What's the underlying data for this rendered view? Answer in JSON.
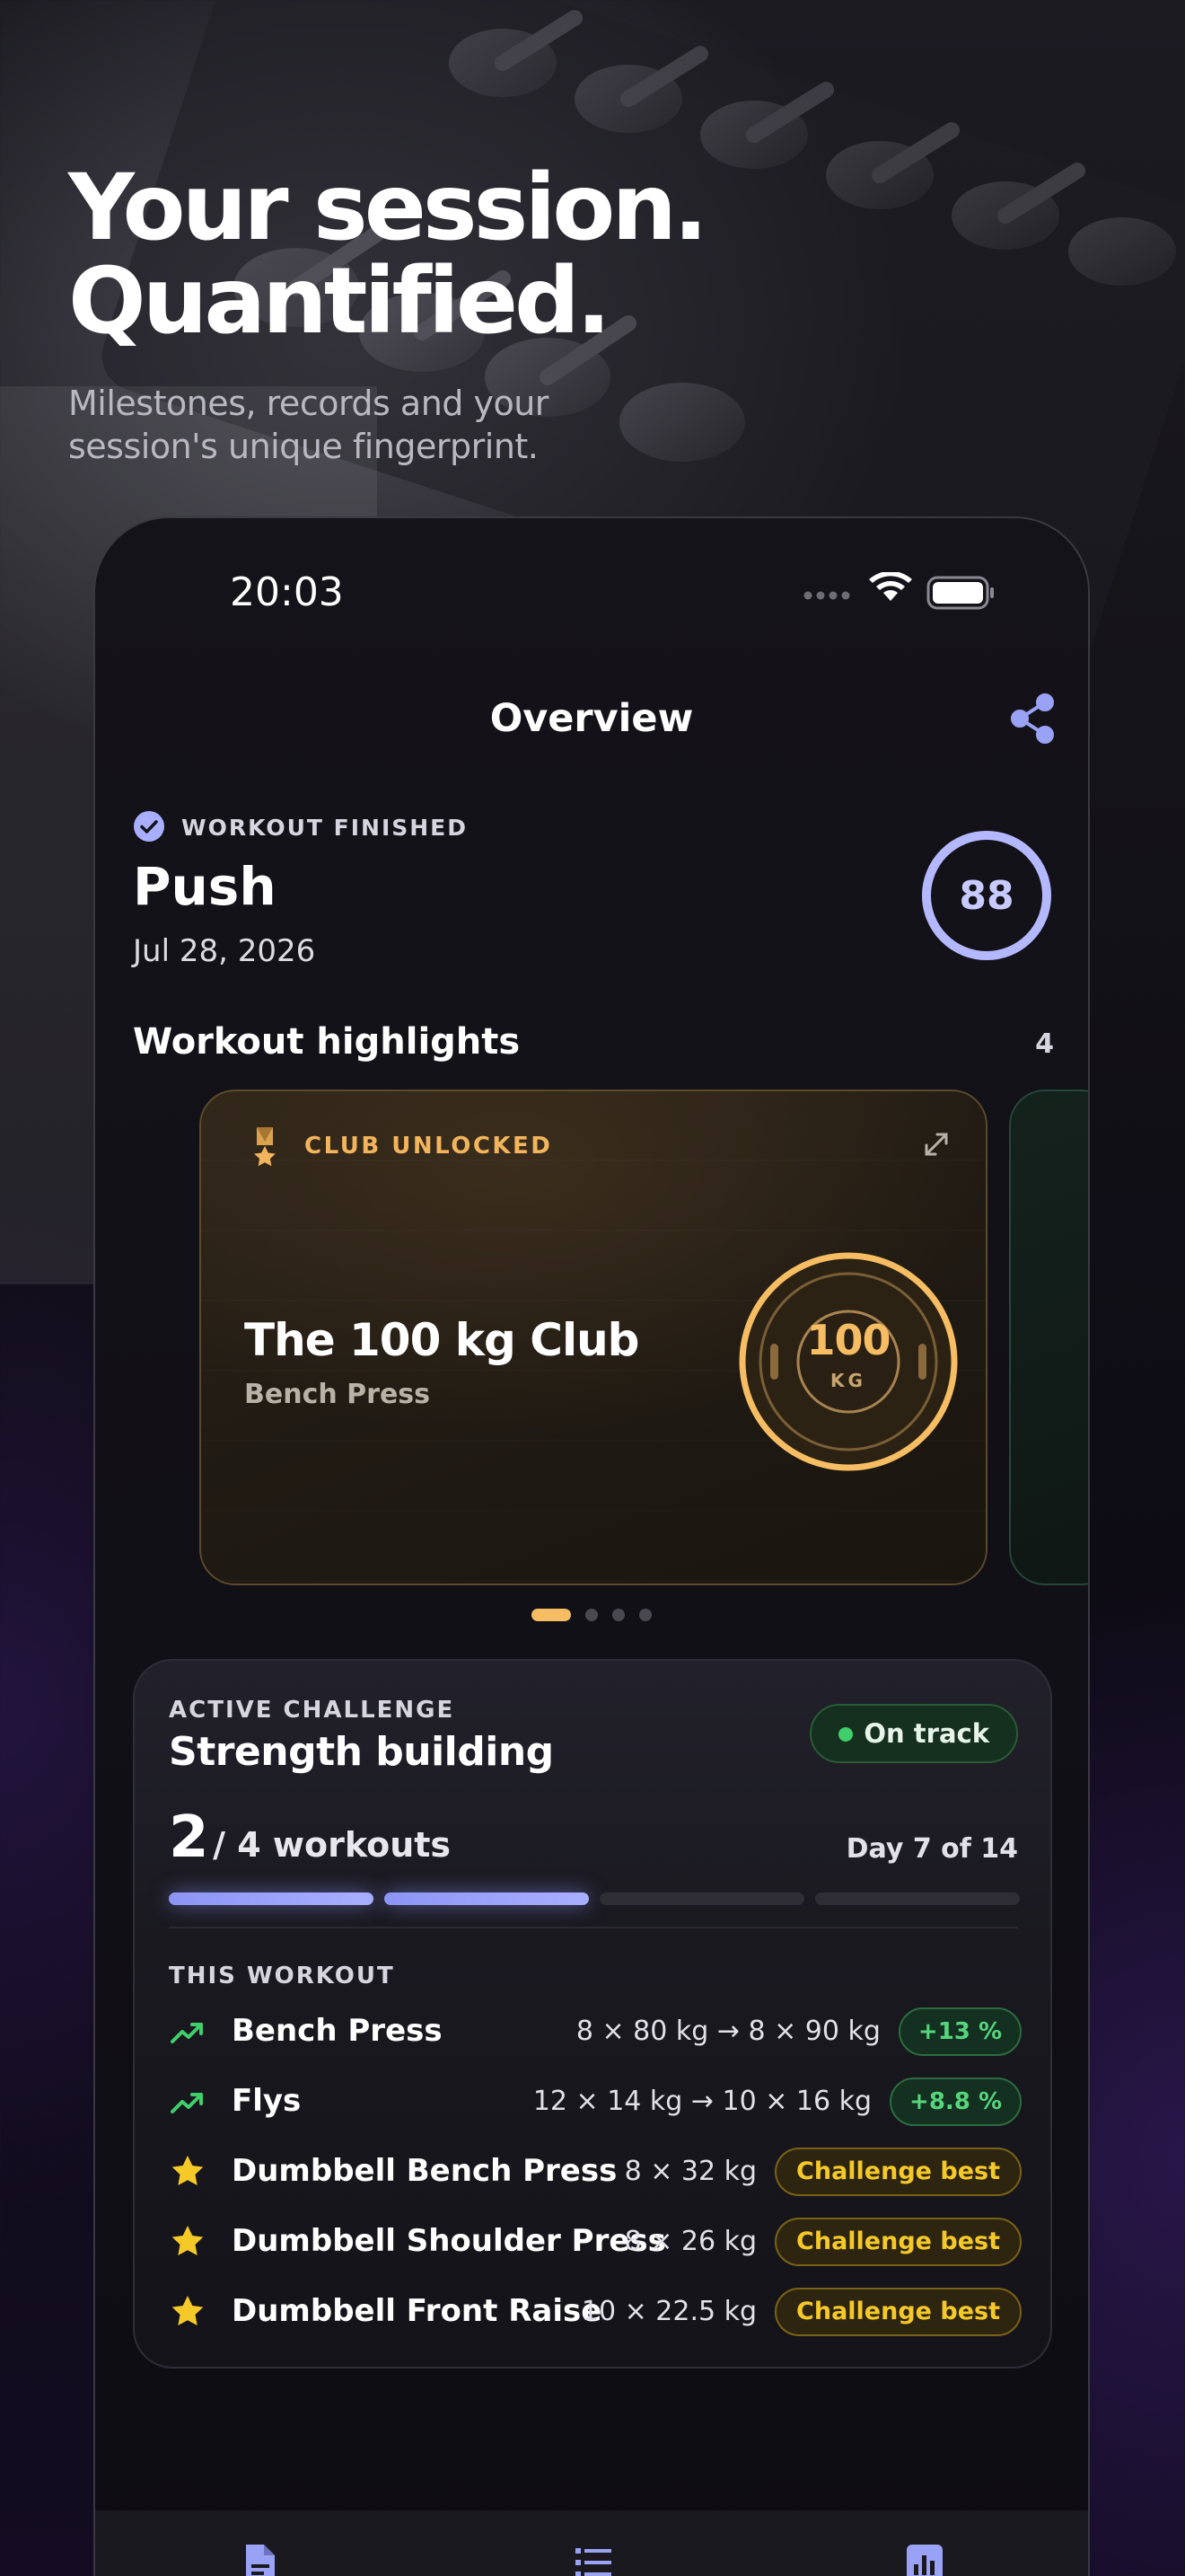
{
  "hero": {
    "title": "Your session.\nQuantified.",
    "subtitle": "Milestones, records and your session's unique fingerprint."
  },
  "status_bar": {
    "time": "20:03",
    "icons": [
      "signal-dots-icon",
      "wifi-icon",
      "battery-icon"
    ]
  },
  "nav": {
    "title": "Overview",
    "share_icon": "share-icon"
  },
  "workout": {
    "status_label": "WORKOUT FINISHED",
    "name": "Push",
    "date": "Jul 28, 2026",
    "score": "88",
    "score_fraction": 0.88
  },
  "highlights": {
    "title": "Workout highlights",
    "count": "4",
    "cards": [
      {
        "label": "CLUB UNLOCKED",
        "name": "The 100 kg Club",
        "exercise": "Bench Press",
        "plate_value": "100",
        "plate_unit": "KG"
      }
    ],
    "active_index": 0,
    "total": 4
  },
  "challenge": {
    "label": "ACTIVE CHALLENGE",
    "name": "Strength building",
    "status": "On track",
    "progress_done": "2",
    "progress_total": "/ 4 workouts",
    "completed_segments": 2,
    "total_segments": 4,
    "day": "Day 7 of 14",
    "this_workout_label": "THIS WORKOUT",
    "exercises": [
      {
        "icon": "trend-up-icon",
        "name": "Bench Press",
        "detail": "8 × 80 kg → 8 × 90 kg",
        "badge": "+13 %",
        "badge_type": "green"
      },
      {
        "icon": "trend-up-icon",
        "name": "Flys",
        "detail": "12 × 14 kg → 10 × 16 kg",
        "badge": "+8.8 %",
        "badge_type": "green"
      },
      {
        "icon": "star-icon",
        "name": "Dumbbell Bench Press",
        "detail": "8 × 32 kg",
        "badge": "Challenge best",
        "badge_type": "gold"
      },
      {
        "icon": "star-icon",
        "name": "Dumbbell Shoulder Press",
        "detail": "8 × 26 kg",
        "badge": "Challenge best",
        "badge_type": "gold"
      },
      {
        "icon": "star-icon",
        "name": "Dumbbell Front Raise",
        "detail": "10 × 22.5 kg",
        "badge": "Challenge best",
        "badge_type": "gold"
      }
    ]
  },
  "tabbar": {
    "icons": [
      "document-icon",
      "list-icon",
      "chart-icon"
    ]
  },
  "colors": {
    "accent": "#a9afff",
    "gold": "#f6bd63",
    "green": "#3fcf6a",
    "star": "#f5c928"
  }
}
